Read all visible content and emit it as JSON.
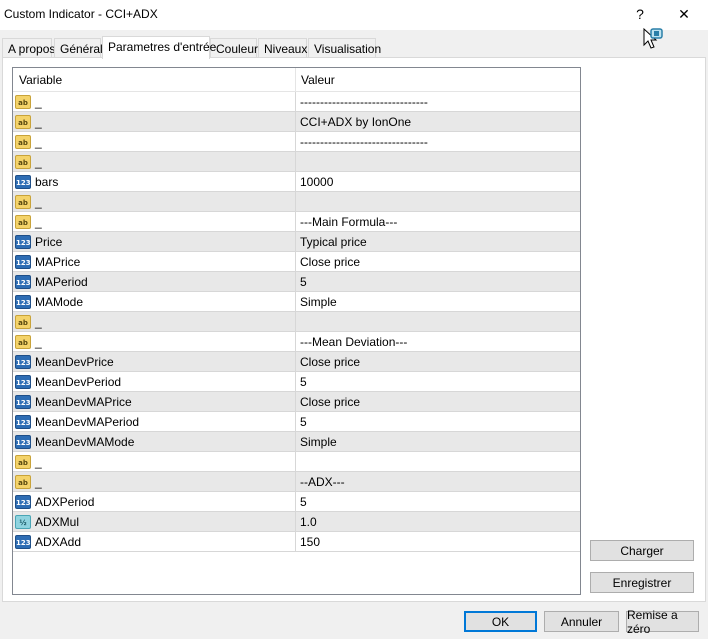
{
  "window": {
    "title": "Custom Indicator - CCI+ADX",
    "help_label": "?",
    "close_label": "✕"
  },
  "tabs": [
    {
      "label": "A propos",
      "active": false
    },
    {
      "label": "Général",
      "active": false
    },
    {
      "label": "Parametres d'entrée",
      "active": true
    },
    {
      "label": "Couleur",
      "active": false
    },
    {
      "label": "Niveaux",
      "active": false
    },
    {
      "label": "Visualisation",
      "active": false
    }
  ],
  "table": {
    "columns": [
      "Variable",
      "Valeur"
    ],
    "rows": [
      {
        "type": "ab",
        "type_label": "ab",
        "name": "_",
        "value": "--------------------------------"
      },
      {
        "type": "ab",
        "type_label": "ab",
        "name": "_",
        "value": "CCI+ADX by IonOne"
      },
      {
        "type": "ab",
        "type_label": "ab",
        "name": "_",
        "value": "--------------------------------"
      },
      {
        "type": "ab",
        "type_label": "ab",
        "name": "_",
        "value": ""
      },
      {
        "type": "n123",
        "type_label": "123",
        "name": "bars",
        "value": "10000"
      },
      {
        "type": "ab",
        "type_label": "ab",
        "name": "_",
        "value": ""
      },
      {
        "type": "ab",
        "type_label": "ab",
        "name": "_",
        "value": "---Main Formula---"
      },
      {
        "type": "n123",
        "type_label": "123",
        "name": "Price",
        "value": "Typical price"
      },
      {
        "type": "n123",
        "type_label": "123",
        "name": "MAPrice",
        "value": "Close price"
      },
      {
        "type": "n123",
        "type_label": "123",
        "name": "MAPeriod",
        "value": "5"
      },
      {
        "type": "n123",
        "type_label": "123",
        "name": "MAMode",
        "value": "Simple"
      },
      {
        "type": "ab",
        "type_label": "ab",
        "name": "_",
        "value": ""
      },
      {
        "type": "ab",
        "type_label": "ab",
        "name": "_",
        "value": "---Mean Deviation---"
      },
      {
        "type": "n123",
        "type_label": "123",
        "name": "MeanDevPrice",
        "value": "Close price"
      },
      {
        "type": "n123",
        "type_label": "123",
        "name": "MeanDevPeriod",
        "value": "5"
      },
      {
        "type": "n123",
        "type_label": "123",
        "name": "MeanDevMAPrice",
        "value": "Close price"
      },
      {
        "type": "n123",
        "type_label": "123",
        "name": "MeanDevMAPeriod",
        "value": "5"
      },
      {
        "type": "n123",
        "type_label": "123",
        "name": "MeanDevMAMode",
        "value": "Simple"
      },
      {
        "type": "ab",
        "type_label": "ab",
        "name": "_",
        "value": ""
      },
      {
        "type": "ab",
        "type_label": "ab",
        "name": "_",
        "value": "--ADX---"
      },
      {
        "type": "n123",
        "type_label": "123",
        "name": "ADXPeriod",
        "value": "5"
      },
      {
        "type": "half",
        "type_label": "½",
        "name": "ADXMul",
        "value": "1.0"
      },
      {
        "type": "n123",
        "type_label": "123",
        "name": "ADXAdd",
        "value": "150"
      }
    ]
  },
  "side_buttons": {
    "load_label": "Charger",
    "save_label": "Enregistrer"
  },
  "footer": {
    "ok_label": "OK",
    "cancel_label": "Annuler",
    "reset_label": "Remise a zéro"
  },
  "colors": {
    "dialog_bg": "#f0f0f0",
    "alt_row": "#e8e8e8",
    "string_icon": "#f4d36a",
    "int_icon": "#2e6db4",
    "double_icon": "#8fd3df",
    "default_button_border": "#0078d7"
  }
}
